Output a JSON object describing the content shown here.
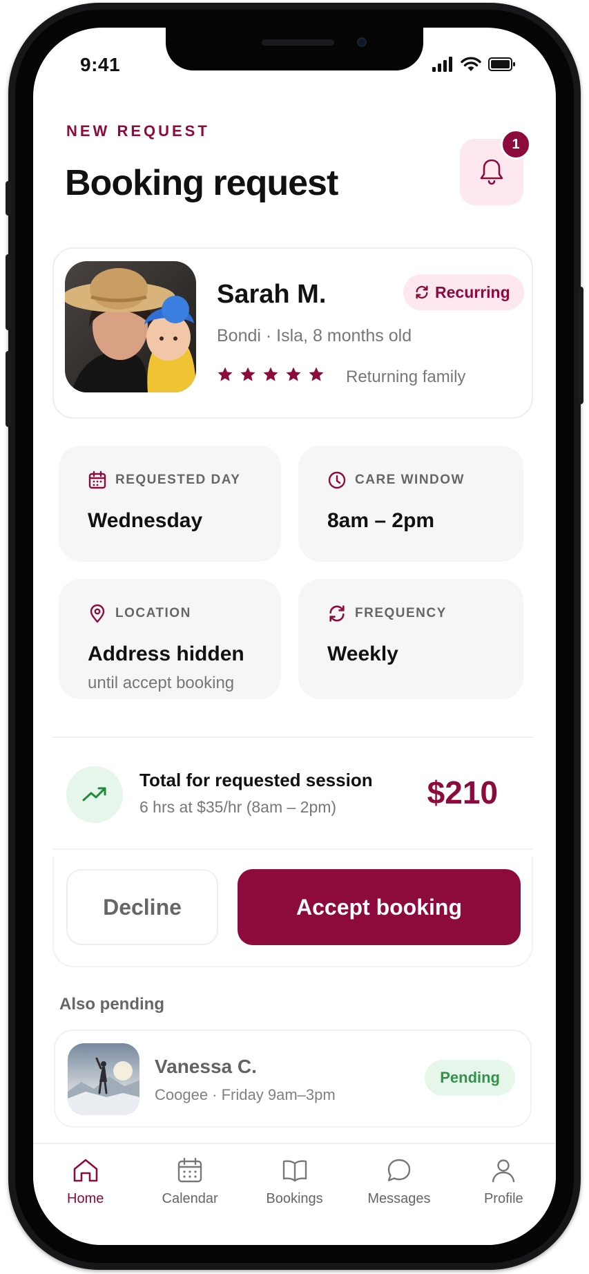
{
  "status_bar": {
    "time": "9:41"
  },
  "header": {
    "eyebrow": "NEW REQUEST",
    "title": "Booking request",
    "notification_count": "1"
  },
  "request": {
    "name": "Sarah M.",
    "details": "Bondi · Isla, 8 months old",
    "rating_stars": 5,
    "rating_note": "Returning family",
    "tag": "Recurring"
  },
  "info": {
    "requested_day": {
      "label": "REQUESTED DAY",
      "value": "Wednesday"
    },
    "care_window": {
      "label": "CARE WINDOW",
      "value": "8am – 2pm"
    },
    "location": {
      "label": "LOCATION",
      "value": "Address hidden",
      "note": "until accept booking"
    },
    "frequency": {
      "label": "FREQUENCY",
      "value": "Weekly"
    }
  },
  "total": {
    "title": "Total for requested session",
    "breakdown": "6 hrs at $35/hr (8am – 2pm)",
    "amount": "$210"
  },
  "actions": {
    "decline": "Decline",
    "accept": "Accept booking"
  },
  "pending": {
    "section_label": "Also pending",
    "items": [
      {
        "name": "Vanessa C.",
        "details": "Coogee · Friday 9am–3pm",
        "status": "Pending"
      }
    ]
  },
  "tabbar": {
    "items": [
      {
        "label": "Home",
        "icon": "home-icon",
        "active": true
      },
      {
        "label": "Calendar",
        "icon": "calendar-icon",
        "active": false
      },
      {
        "label": "Bookings",
        "icon": "book-icon",
        "active": false
      },
      {
        "label": "Messages",
        "icon": "message-icon",
        "active": false
      },
      {
        "label": "Profile",
        "icon": "person-icon",
        "active": false
      }
    ]
  },
  "colors": {
    "accent": "#8c0a3c",
    "accent_soft": "#fce8ee",
    "success": "#1f8a3a",
    "success_soft": "#e6f6ea",
    "tile_bg": "#f6f6f6"
  }
}
